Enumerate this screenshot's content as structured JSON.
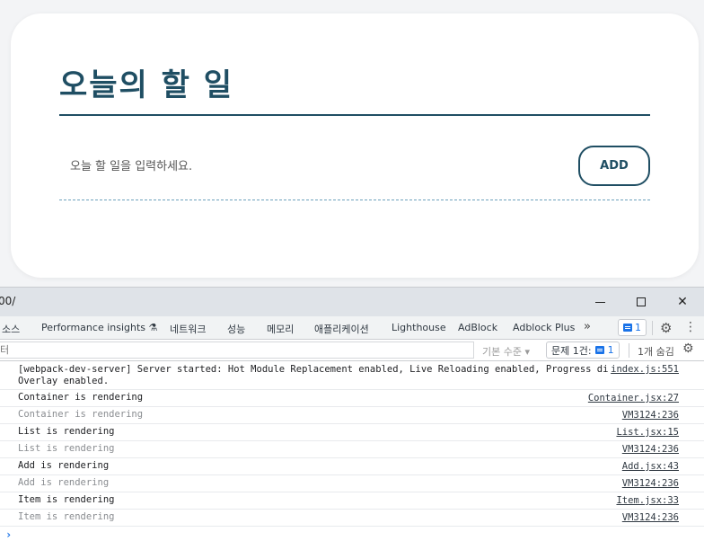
{
  "app": {
    "title": "오늘의 할 일",
    "input_placeholder": "오늘 할 일을 입력하세요.",
    "add_label": "ADD"
  },
  "devtools": {
    "url": "00/",
    "tabs": [
      "소스",
      "Performance insights ⚗",
      "네트워크",
      "성능",
      "메모리",
      "애플리케이션",
      "Lighthouse",
      "AdBlock",
      "Adblock Plus"
    ],
    "more_tabs": "»",
    "issues_badge_count": "1",
    "filter_placeholder": "터",
    "level_select": "기본 수준 ▾",
    "issues_label": "문제 1건:",
    "issues_count": "1",
    "hidden_count": "1개 숨김",
    "logs": [
      {
        "text": "[webpack-dev-server] Server started: Hot Module Replacement enabled, Live Reloading enabled, Progress disabled,\nOverlay enabled.",
        "source": "index.js:551",
        "dim": false
      },
      {
        "text": "Container is rendering",
        "source": "Container.jsx:27",
        "dim": false
      },
      {
        "text": "Container is rendering",
        "source": "VM3124:236",
        "dim": true
      },
      {
        "text": "List is rendering",
        "source": "List.jsx:15",
        "dim": false
      },
      {
        "text": "List is rendering",
        "source": "VM3124:236",
        "dim": true
      },
      {
        "text": "Add is rendering",
        "source": "Add.jsx:43",
        "dim": false
      },
      {
        "text": "Add is rendering",
        "source": "VM3124:236",
        "dim": true
      },
      {
        "text": "Item is rendering",
        "source": "Item.jsx:33",
        "dim": false
      },
      {
        "text": "Item is rendering",
        "source": "VM3124:236",
        "dim": true
      }
    ],
    "prompt": "›"
  }
}
